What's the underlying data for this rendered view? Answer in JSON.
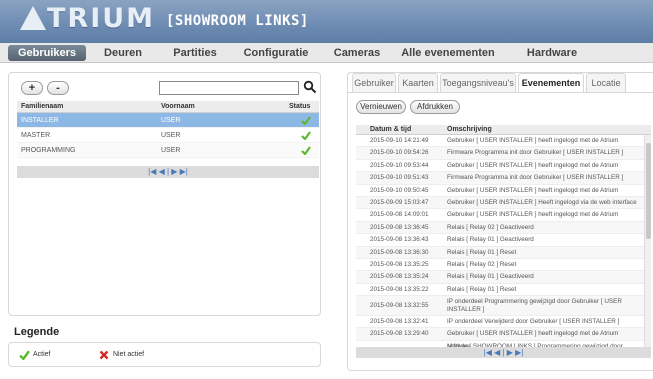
{
  "header": {
    "logo_text": "TRIUM",
    "subtitle": "[SHOWROOM LINKS]"
  },
  "nav": {
    "items": [
      "Gebruikers",
      "Deuren",
      "Partities",
      "Configuratie",
      "Cameras",
      "Alle evenementen",
      "Hardware"
    ],
    "active": "Gebruikers"
  },
  "users": {
    "add_label": "+",
    "remove_label": "-",
    "search_placeholder": "",
    "columns": [
      "Familienaam",
      "Voornaam",
      "Status"
    ],
    "rows": [
      {
        "familienaam": "INSTALLER",
        "voornaam": "USER",
        "status": "actief"
      },
      {
        "familienaam": "MASTER",
        "voornaam": "USER",
        "status": "actief"
      },
      {
        "familienaam": "PROGRAMMING",
        "voornaam": "USER",
        "status": "actief"
      }
    ],
    "pager": "|◀  ◀  |  ▶  ▶|"
  },
  "legend": {
    "title": "Legende",
    "actief": "Actief",
    "niet_actief": "Niet actief"
  },
  "right": {
    "tabs": [
      "Gebruiker",
      "Kaarten",
      "Toegangsniveau's",
      "Evenementen",
      "Locatie"
    ],
    "active_tab": "Evenementen",
    "refresh_label": "Vernieuwen",
    "print_label": "Afdrukken",
    "columns": [
      "Datum & tijd",
      "Omschrijving"
    ],
    "events": [
      {
        "date": "2015-09-10 14:21:49",
        "desc": "Gebruiker [ USER INSTALLER ] heeft ingelogd met de Atrium software"
      },
      {
        "date": "2015-09-10 09:54:26",
        "desc": "Firmware Programma init door Gebruiker [ USER INSTALLER ]"
      },
      {
        "date": "2015-09-10 09:53:44",
        "desc": "Gebruiker [ USER INSTALLER ] heeft ingelogd met de Atrium software"
      },
      {
        "date": "2015-09-10 09:51:43",
        "desc": "Firmware Programma init door Gebruiker [ USER INSTALLER ]"
      },
      {
        "date": "2015-09-10 09:50:45",
        "desc": "Gebruiker [ USER INSTALLER ] heeft ingelogd met de Atrium software"
      },
      {
        "date": "2015-09-09 15:03:47",
        "desc": "Gebruiker [ USER INSTALLER ] Heeft ingelogd via de web interface"
      },
      {
        "date": "2015-09-08 14:09:01",
        "desc": "Gebruiker [ USER INSTALLER ] heeft ingelogd met de Atrium software"
      },
      {
        "date": "2015-09-08 13:36:45",
        "desc": "Relais [ Relay 02 ] Geactiveerd"
      },
      {
        "date": "2015-09-08 13:36:43",
        "desc": "Relais [ Relay 01 ] Geactiveerd"
      },
      {
        "date": "2015-09-08 13:36:30",
        "desc": "Relais [ Relay 01 ] Reset"
      },
      {
        "date": "2015-09-08 13:35:25",
        "desc": "Relais [ Relay 02 ] Reset"
      },
      {
        "date": "2015-09-08 13:35:24",
        "desc": "Relais [ Relay 01 ] Geactiveerd"
      },
      {
        "date": "2015-09-08 13:35:22",
        "desc": "Relais [ Relay 01 ] Reset"
      },
      {
        "date": "2015-09-08 13:32:55",
        "desc": "IP onderdeel Programmering gewijzigd door Gebruiker [ USER INSTALLER ]"
      },
      {
        "date": "2015-09-08 13:32:41",
        "desc": "IP onderdeel Verwijderd door Gebruiker [ USER INSTALLER ]"
      },
      {
        "date": "2015-09-08 13:29:40",
        "desc": "Gebruiker [ USER INSTALLER ] heeft ingelogd met de Atrium software"
      },
      {
        "date": "",
        "desc": "Module [ SHOWROOM LINKS ] Programmering gewijzigd door"
      }
    ],
    "pager": "|◀  ◀  |  ▶  ▶|"
  },
  "colors": {
    "header": "#7390b6",
    "selected_row": "#8db8e6",
    "active_check": "#5cb82e",
    "inactive_cross": "#d42a2a"
  }
}
